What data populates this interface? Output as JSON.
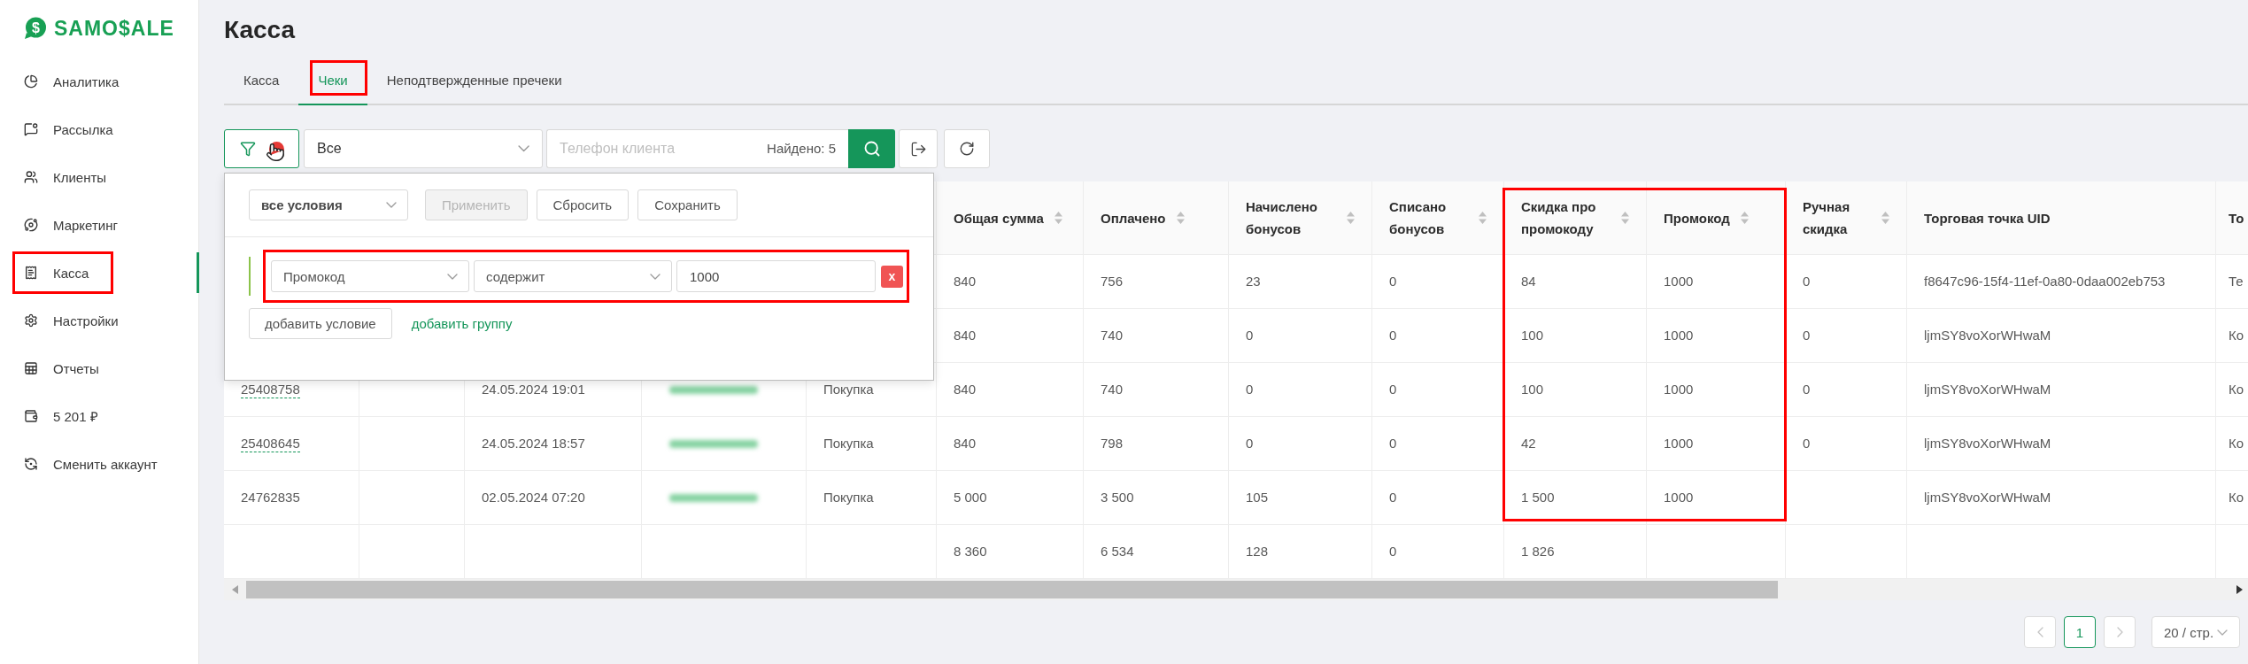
{
  "logo": {
    "mark": "$",
    "text": "SAMO$ALE"
  },
  "sidebar": {
    "items": [
      {
        "label": "Аналитика",
        "selected": false,
        "highlighted": false
      },
      {
        "label": "Рассылка",
        "selected": false,
        "highlighted": false
      },
      {
        "label": "Клиенты",
        "selected": false,
        "highlighted": false
      },
      {
        "label": "Маркетинг",
        "selected": false,
        "highlighted": false
      },
      {
        "label": "Касса",
        "selected": true,
        "highlighted": true
      },
      {
        "label": "Настройки",
        "selected": false,
        "highlighted": false
      },
      {
        "label": "Отчеты",
        "selected": false,
        "highlighted": false
      },
      {
        "label": "5 201 ₽",
        "selected": false,
        "highlighted": false
      },
      {
        "label": "Сменить аккаунт",
        "selected": false,
        "highlighted": false
      }
    ]
  },
  "page": {
    "title": "Касса"
  },
  "tabs": [
    {
      "label": "Касса",
      "selected": false,
      "highlighted": false
    },
    {
      "label": "Чеки",
      "selected": true,
      "highlighted": true
    },
    {
      "label": "Неподтвержденные пречеки",
      "selected": false,
      "highlighted": false
    }
  ],
  "toolbar": {
    "filter_badge": true,
    "status_select": "Все",
    "phone_search": {
      "placeholder": "Телефон клиента",
      "found": "Найдено: 5"
    }
  },
  "filter_panel": {
    "match_select": "все условия",
    "buttons": [
      {
        "label": "Применить",
        "disabled": true
      },
      {
        "label": "Сбросить",
        "disabled": false
      },
      {
        "label": "Сохранить",
        "disabled": false
      }
    ],
    "conditions": [
      {
        "field": "Промокод",
        "operator": "содержит",
        "value": "1000",
        "remove_label": "x",
        "highlighted": true
      }
    ],
    "add_condition": "добавить условие",
    "add_group": "добавить группу"
  },
  "table": {
    "columns": [
      {
        "label": "Общая сумма",
        "sortable": true,
        "highlighted": false
      },
      {
        "label": "Оплачено",
        "sortable": true,
        "highlighted": false
      },
      {
        "label": "Начислено бонусов",
        "sortable": true,
        "highlighted": false
      },
      {
        "label": "Списано бонусов",
        "sortable": true,
        "highlighted": false
      },
      {
        "label": "Скидка про промокоду",
        "sortable": true,
        "highlighted": true
      },
      {
        "label": "Промокод",
        "sortable": true,
        "highlighted": true
      },
      {
        "label": "Ручная скидка",
        "sortable": true,
        "highlighted": false
      },
      {
        "label": "Торговая точка UID",
        "sortable": false,
        "highlighted": false
      },
      {
        "label": "То",
        "sortable": false,
        "highlighted": false
      }
    ],
    "rows": [
      {
        "total_amount": "840",
        "paid": "756",
        "bonuses_accrued": "23",
        "bonuses_spent": "0",
        "promo_discount": "84",
        "promo_code": "1000",
        "manual_discount": "0",
        "outlet_uid": "f8647c96-15f4-11ef-0a80-0daa002eb753",
        "column_14": "Те"
      },
      {
        "total_amount": "840",
        "paid": "740",
        "bonuses_accrued": "0",
        "bonuses_spent": "0",
        "promo_discount": "100",
        "promo_code": "1000",
        "manual_discount": "0",
        "outlet_uid": "ljmSY8voXorWHwaM",
        "column_14": "Ко"
      },
      {
        "column_1": "25408758",
        "column_1_link": true,
        "column_3": "24.05.2024 19:01",
        "column_4_blurred": true,
        "column_5": "Покупка",
        "total_amount": "840",
        "paid": "740",
        "bonuses_accrued": "0",
        "bonuses_spent": "0",
        "promo_discount": "100",
        "promo_code": "1000",
        "manual_discount": "0",
        "outlet_uid": "ljmSY8voXorWHwaM",
        "column_14": "Ко"
      },
      {
        "column_1": "25408645",
        "column_1_link": true,
        "column_3": "24.05.2024 18:57",
        "column_4_blurred": true,
        "column_5": "Покупка",
        "total_amount": "840",
        "paid": "798",
        "bonuses_accrued": "0",
        "bonuses_spent": "0",
        "promo_discount": "42",
        "promo_code": "1000",
        "manual_discount": "0",
        "outlet_uid": "ljmSY8voXorWHwaM",
        "column_14": "Ко"
      },
      {
        "column_1": "24762835",
        "column_1_link": false,
        "column_3": "02.05.2024 07:20",
        "column_4_blurred": true,
        "column_5": "Покупка",
        "total_amount": "5 000",
        "paid": "3 500",
        "bonuses_accrued": "105",
        "bonuses_spent": "0",
        "promo_discount": "1 500",
        "promo_code": "1000",
        "outlet_uid": "ljmSY8voXorWHwaM",
        "column_14": "Ко"
      }
    ],
    "totals": [
      "8 360",
      "6 534",
      "128",
      "0",
      "1 826"
    ]
  },
  "pagination": {
    "prev_disabled": true,
    "pages": [
      {
        "label": "1",
        "selected": true
      }
    ],
    "next_disabled": true,
    "page_size": "20 / стр."
  }
}
